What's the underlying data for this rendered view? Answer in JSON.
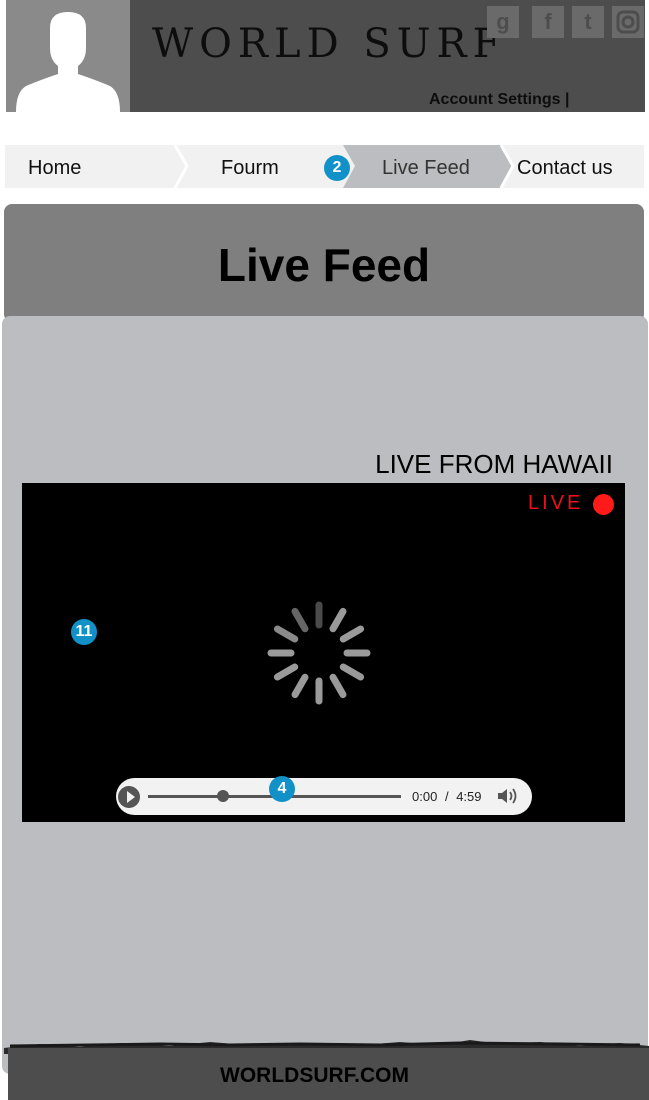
{
  "header": {
    "logo": "WORLD SURF",
    "account_settings": "Account Settings |",
    "social": [
      {
        "icon": "google-plus-icon",
        "glyph": "g"
      },
      {
        "icon": "facebook-icon",
        "glyph": "f"
      },
      {
        "icon": "twitter-icon",
        "glyph": "t"
      },
      {
        "icon": "instagram-icon",
        "glyph": ""
      }
    ]
  },
  "nav": {
    "items": [
      {
        "label": "Home"
      },
      {
        "label": "Fourm"
      },
      {
        "label": "Live Feed",
        "active": true
      },
      {
        "label": "Contact us"
      }
    ],
    "badge": "2"
  },
  "page": {
    "title": "Live Feed",
    "stream_title": "LIVE FROM HAWAII"
  },
  "video": {
    "live_label": "LIVE",
    "badge": "11",
    "controls": {
      "current_time": "0:00",
      "separator": "/",
      "duration": "4:59",
      "badge": "4"
    }
  },
  "footer": {
    "text": "WORLDSURF.COM"
  },
  "colors": {
    "header_bg": "#4d4d4d",
    "banner_bg": "#7f7f7f",
    "panel_bg": "#bcbdc0",
    "badge_blue": "#1291c8",
    "live_red": "#ff1a1a"
  }
}
